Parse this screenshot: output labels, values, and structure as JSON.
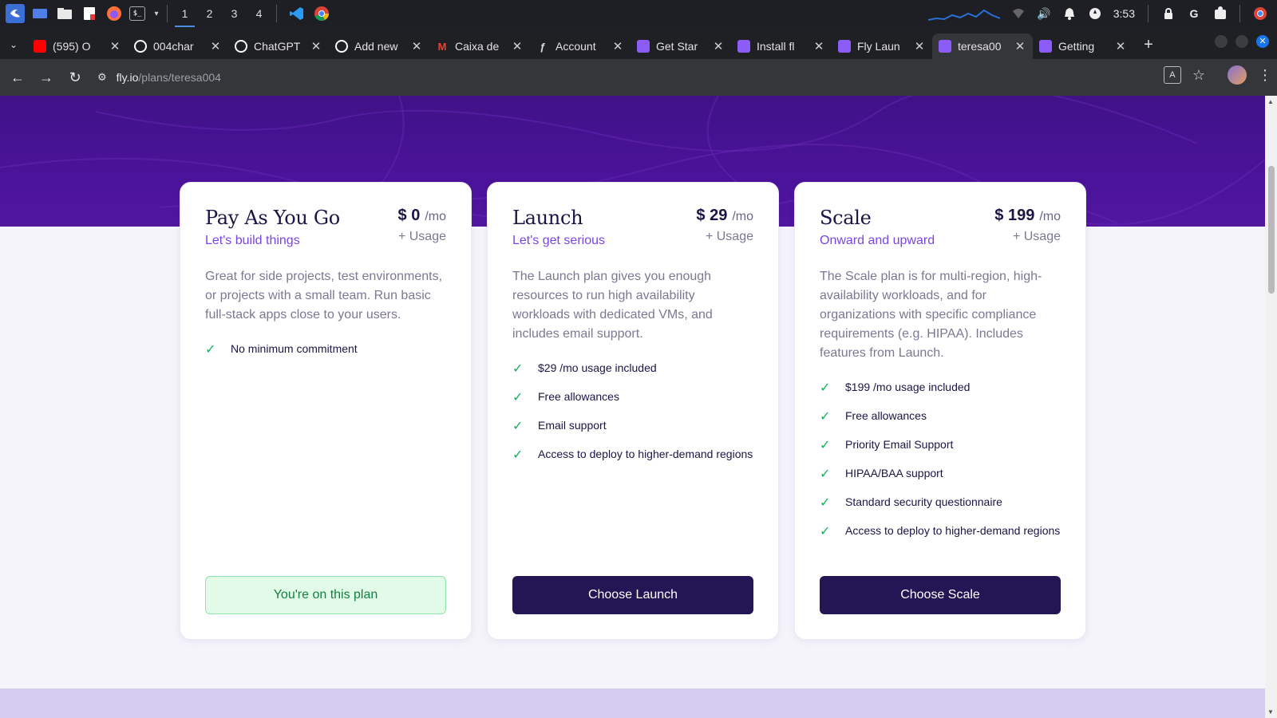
{
  "taskbar": {
    "workspaces": [
      "1",
      "2",
      "3",
      "4"
    ],
    "clock": "3:53"
  },
  "tabs": [
    {
      "title": "(595) O",
      "favicon": "youtube-icon",
      "color": "#ff0000"
    },
    {
      "title": "004char",
      "favicon": "github-icon",
      "color": "#ffffff"
    },
    {
      "title": "ChatGPT",
      "favicon": "chatgpt-icon",
      "color": "#ffffff"
    },
    {
      "title": "Add new",
      "favicon": "github-icon",
      "color": "#ffffff"
    },
    {
      "title": "Caixa de",
      "favicon": "gmail-icon",
      "color": "#ea4335"
    },
    {
      "title": "Account",
      "favicon": "clerk-icon",
      "color": "#6c47ff"
    },
    {
      "title": "Get Star",
      "favicon": "fly-icon",
      "color": "#8b5cf6"
    },
    {
      "title": "Install fl",
      "favicon": "fly-icon",
      "color": "#8b5cf6"
    },
    {
      "title": "Fly Laun",
      "favicon": "fly-icon",
      "color": "#8b5cf6"
    },
    {
      "title": "teresa00",
      "favicon": "fly-icon",
      "color": "#8b5cf6",
      "active": true
    },
    {
      "title": "Getting",
      "favicon": "fly-icon",
      "color": "#8b5cf6"
    }
  ],
  "address": {
    "host": "fly.io",
    "path": "/plans/teresa004"
  },
  "plans": [
    {
      "name": "Pay As You Go",
      "amount": "$ 0",
      "per": "/mo",
      "usage": "+ Usage",
      "tagline": "Let's build things",
      "description": "Great for side projects, test environments, or projects with a small team. Run basic full-stack apps close to your users.",
      "features": [
        "No minimum commitment"
      ],
      "button": "You're on this plan"
    },
    {
      "name": "Launch",
      "amount": "$ 29",
      "per": "/mo",
      "usage": "+ Usage",
      "tagline": "Let's get serious",
      "description": "The Launch plan gives you enough resources to run high availability workloads with dedicated VMs, and includes email support.",
      "features": [
        "$29 /mo usage included",
        "Free allowances",
        "Email support",
        "Access to deploy to higher-demand regions"
      ],
      "button": "Choose Launch"
    },
    {
      "name": "Scale",
      "amount": "$ 199",
      "per": "/mo",
      "usage": "+ Usage",
      "tagline": "Onward and upward",
      "description": "The Scale plan is for multi-region, high-availability workloads, and for organizations with specific compliance requirements (e.g. HIPAA). Includes features from Launch.",
      "features": [
        "$199 /mo usage included",
        "Free allowances",
        "Priority Email Support",
        "HIPAA/BAA support",
        "Standard security questionnaire",
        "Access to deploy to higher-demand regions"
      ],
      "button": "Choose Scale"
    }
  ],
  "colors": {
    "hero": "#4a1399",
    "accent": "#7a45e8",
    "primary_button": "#241555",
    "check": "#16b35a"
  }
}
